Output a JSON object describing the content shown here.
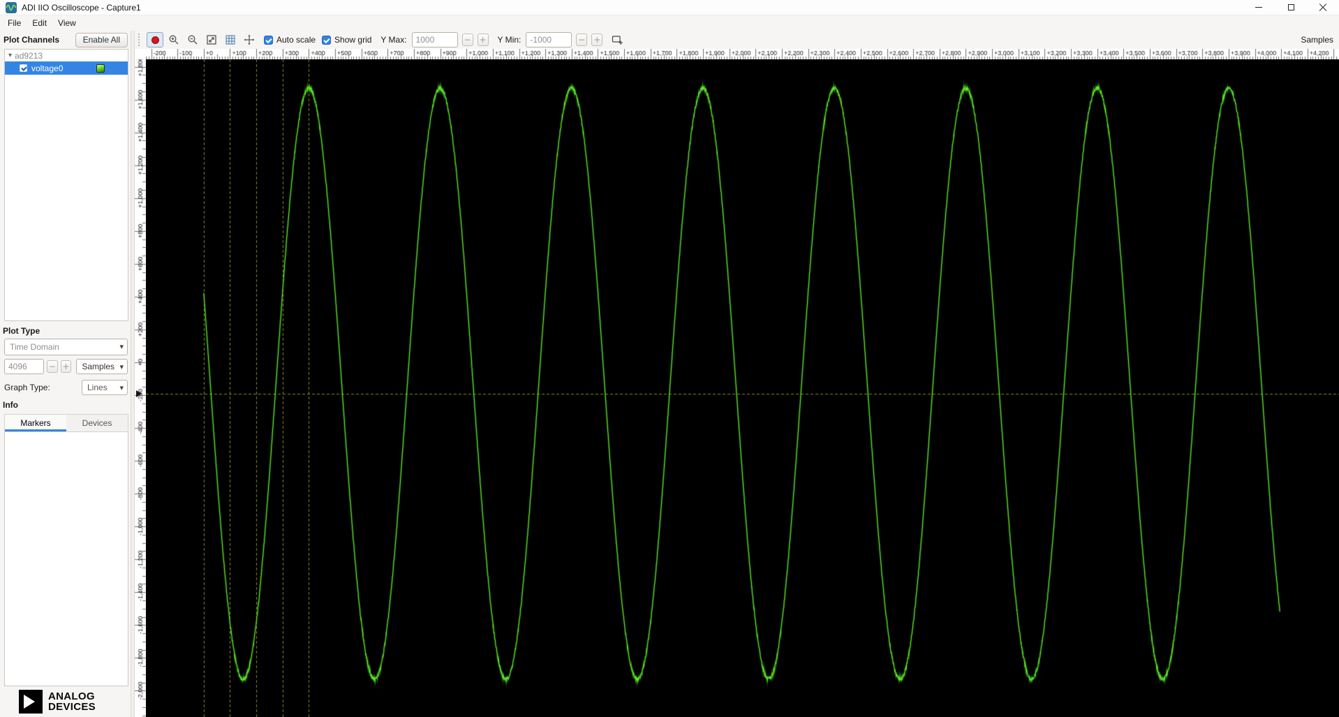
{
  "window": {
    "title": "ADI IIO Oscilloscope - Capture1"
  },
  "menu": {
    "items": [
      "File",
      "Edit",
      "View"
    ]
  },
  "glyphs": {
    "chevron_down": "▾",
    "expander_down": "▾",
    "minus": "−",
    "plus": "+"
  },
  "left_panel": {
    "plot_channels_label": "Plot Channels",
    "enable_all_button": "Enable All",
    "tree": {
      "device": "ad9213",
      "channel": "voltage0",
      "channel_checked": true
    },
    "plot_type_label": "Plot Type",
    "plot_type_value": "Time Domain",
    "samples_value": "4096",
    "samples_unit_value": "Samples",
    "graph_type_label": "Graph Type:",
    "graph_type_value": "Lines",
    "info_label": "Info",
    "tabs": [
      "Markers",
      "Devices"
    ],
    "active_tab": 0
  },
  "toolbar": {
    "auto_scale_label": "Auto scale",
    "auto_scale_checked": true,
    "show_grid_label": "Show grid",
    "show_grid_checked": true,
    "y_max_label": "Y Max:",
    "y_max_value": "1000",
    "y_min_label": "Y Min:",
    "y_min_value": "-1000",
    "axis_unit_label": "Samples"
  },
  "logo": {
    "line1": "ANALOG",
    "line2": "DEVICES"
  },
  "chart_data": {
    "type": "line",
    "title": "",
    "x_axis": {
      "unit": "Samples",
      "min": -220,
      "max": 4320,
      "major_tick": 100,
      "mid_tick": 50,
      "minor_tick": 10,
      "label_format": "signed_thousands"
    },
    "y_axis": {
      "min": -2160,
      "max": 1845,
      "major_tick": 200,
      "mid_tick": 50,
      "tick_labels_from": -2000,
      "tick_labels_to": 1800
    },
    "series": [
      {
        "name": "ad9213 voltage0",
        "color": "#5be627",
        "waveform": "sine",
        "samples": 4096,
        "amplitude": 1800,
        "offset": -130,
        "period_samples": 500,
        "peak_sample": 400,
        "noise_amplitude": 12
      }
    ],
    "markers": {
      "color": "#86862c",
      "h_lines": [
        -190
      ],
      "v_lines": [
        0,
        100,
        200,
        300,
        400
      ]
    },
    "plot_background": "#000000",
    "grid": true,
    "legend": false
  }
}
